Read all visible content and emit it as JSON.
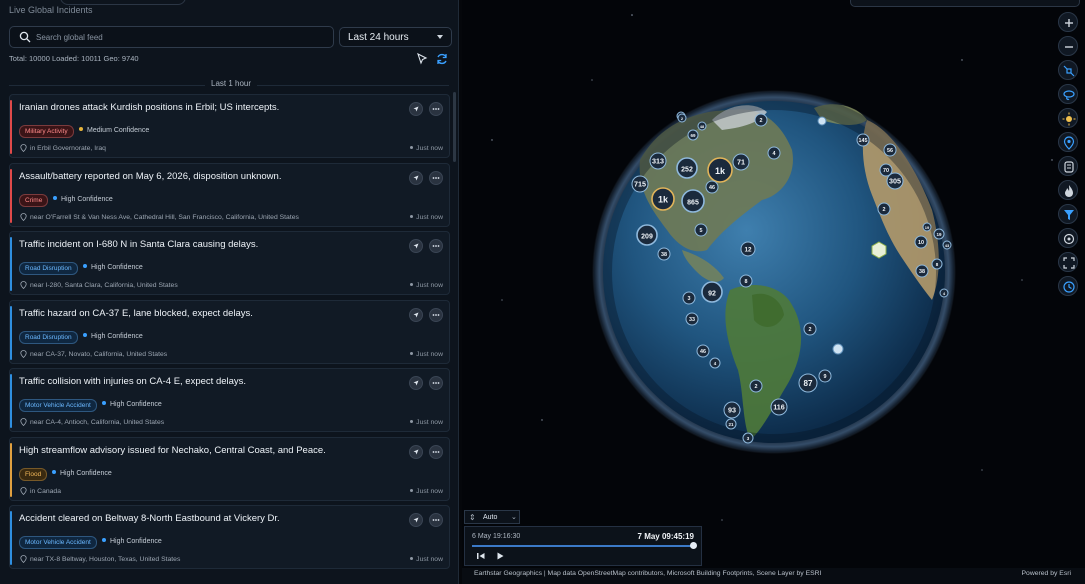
{
  "panel": {
    "subtitle": "Live Global Incidents",
    "search_placeholder": "Search global feed",
    "time_range": "Last 24 hours",
    "stats": "Total: 10000  Loaded: 10011  Geo: 9740",
    "section_header": "Last 1 hour"
  },
  "incidents": [
    {
      "title": "Iranian drones attack Kurdish positions in Erbil; US intercepts.",
      "category": "Military Activity",
      "confidence": "Medium Confidence",
      "location": "in Erbil Governorate, Iraq",
      "time": "Just now",
      "bar": "#e04a4a",
      "badge_bg": "#3a1417",
      "badge_fg": "#ff8a8a",
      "conf_color": "#e7b53b"
    },
    {
      "title": "Assault/battery reported on May 6, 2026, disposition unknown.",
      "category": "Crime",
      "confidence": "High Confidence",
      "location": "near O'Farrell St & Van Ness Ave, Cathedral Hill, San Francisco, California, United States",
      "time": "Just now",
      "bar": "#e04a4a",
      "badge_bg": "#3a1417",
      "badge_fg": "#ff8a8a",
      "conf_color": "#3aa0ff"
    },
    {
      "title": "Traffic incident on I-680 N in Santa Clara causing delays.",
      "category": "Road Disruption",
      "confidence": "High Confidence",
      "location": "near I-280, Santa Clara, California, United States",
      "time": "Just now",
      "bar": "#2f8fe0",
      "badge_bg": "#0f2740",
      "badge_fg": "#6bb8ff",
      "conf_color": "#3aa0ff"
    },
    {
      "title": "Traffic hazard on CA-37 E, lane blocked, expect delays.",
      "category": "Road Disruption",
      "confidence": "High Confidence",
      "location": "near CA-37, Novato, California, United States",
      "time": "Just now",
      "bar": "#2f8fe0",
      "badge_bg": "#0f2740",
      "badge_fg": "#6bb8ff",
      "conf_color": "#3aa0ff"
    },
    {
      "title": "Traffic collision with injuries on CA-4 E, expect delays.",
      "category": "Motor Vehicle Accident",
      "confidence": "High Confidence",
      "location": "near CA-4, Antioch, California, United States",
      "time": "Just now",
      "bar": "#2f8fe0",
      "badge_bg": "#0f2740",
      "badge_fg": "#6bb8ff",
      "conf_color": "#3aa0ff"
    },
    {
      "title": "High streamflow advisory issued for Nechako, Central Coast, and Peace.",
      "category": "Flood",
      "confidence": "High Confidence",
      "location": "in Canada",
      "time": "Just now",
      "bar": "#e0a040",
      "badge_bg": "#3a2a10",
      "badge_fg": "#f2b85a",
      "conf_color": "#3aa0ff"
    },
    {
      "title": "Accident cleared on Beltway 8-North Eastbound at Vickery Dr.",
      "category": "Motor Vehicle Accident",
      "confidence": "High Confidence",
      "location": "near TX-8 Beltway, Houston, Texas, United States",
      "time": "Just now",
      "bar": "#2f8fe0",
      "badge_bg": "#0f2740",
      "badge_fg": "#6bb8ff",
      "conf_color": "#3aa0ff"
    }
  ],
  "clusters": [
    "313",
    "252",
    "1k",
    "71",
    "715",
    "1k",
    "865",
    "46",
    "209",
    "38",
    "5",
    "12",
    "8",
    "92",
    "3",
    "33",
    "2",
    "46",
    "4",
    "87",
    "9",
    "2",
    "116",
    "93",
    "21",
    "3",
    "3",
    "2",
    "4",
    "2",
    "48",
    "56",
    "70",
    "305",
    "2",
    "38",
    "10",
    "8",
    "19",
    "4",
    "69",
    "43",
    "19",
    "145"
  ],
  "timeline": {
    "mode": "Auto",
    "start": "6 May 19:16:30",
    "end": "7 May 09:45:19",
    "progress": 1.0
  },
  "attribution": {
    "text": "Earthstar Geographics | Map data OpenStreetMap contributors, Microsoft Building Footprints, Scene Layer by ESRI",
    "powered": "Powered by Esri"
  },
  "icons": [
    "search-icon",
    "chevron-down-icon",
    "cursor-icon",
    "refresh-icon",
    "compass-icon",
    "more-icon",
    "location-pin-icon",
    "zoom-in-icon",
    "zoom-out-icon",
    "satellite-icon",
    "lasso-icon",
    "sun-icon",
    "target-icon",
    "layers-icon",
    "fire-icon",
    "filter-icon",
    "crosshair-icon",
    "fullscreen-icon",
    "clock-icon",
    "skip-back-icon",
    "play-icon"
  ]
}
